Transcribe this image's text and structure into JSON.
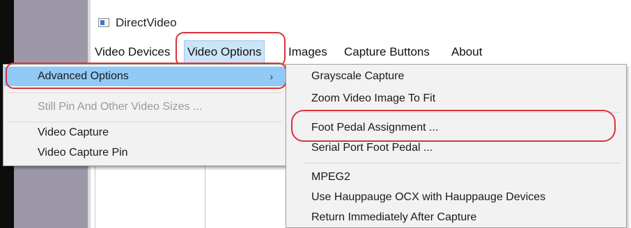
{
  "window": {
    "title": "DirectVideo"
  },
  "menubar": {
    "items": [
      {
        "label": "Video Devices"
      },
      {
        "label": "Video Options"
      },
      {
        "label": "Images"
      },
      {
        "label": "Capture Buttons"
      },
      {
        "label": "About"
      }
    ]
  },
  "menu_video_options": {
    "items": [
      {
        "label": "Advanced Options",
        "submenu_glyph": "›"
      },
      {
        "label": "Still Pin And Other Video Sizes ..."
      },
      {
        "label": "Video Capture"
      },
      {
        "label": "Video Capture Pin"
      }
    ]
  },
  "submenu_advanced": {
    "items": [
      {
        "label": "Grayscale Capture"
      },
      {
        "label": "Zoom Video Image To Fit"
      },
      {
        "label": "Foot Pedal Assignment ..."
      },
      {
        "label": "Serial Port Foot Pedal ..."
      },
      {
        "label": "MPEG2"
      },
      {
        "label": "Use Hauppauge OCX with Hauppauge Devices"
      },
      {
        "label": "Return Immediately After Capture"
      }
    ]
  },
  "colors": {
    "highlight": "#91c9f7",
    "menu_active": "#cce4f7",
    "annotation": "#d9323a"
  }
}
